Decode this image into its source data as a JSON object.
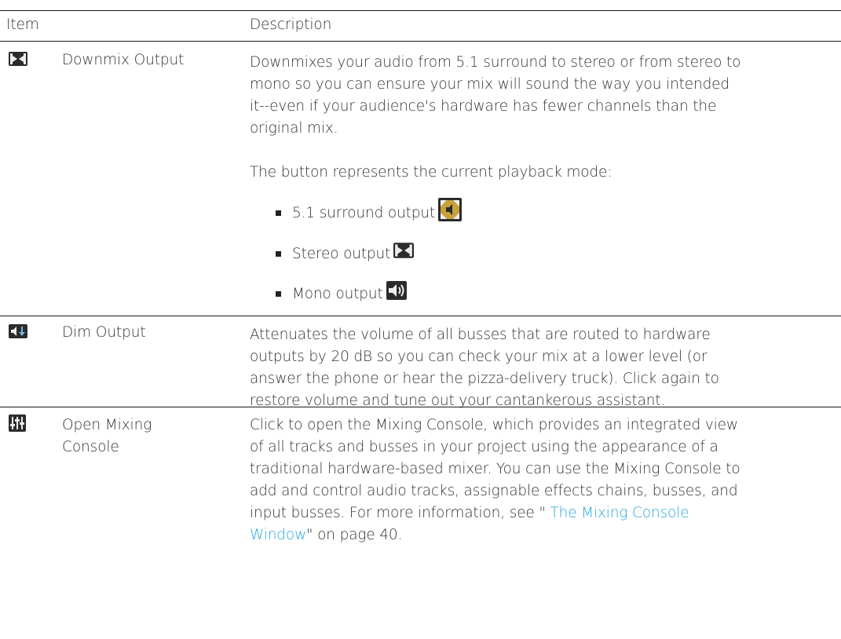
{
  "headers": {
    "item": "Item",
    "description": "Description"
  },
  "rows": [
    {
      "icon": "downmix-stereo-icon",
      "item": "Downmix Output",
      "desc_lines": [
        "Downmixes your audio from 5.1 surround to stereo or from stereo to",
        "mono so you can ensure your mix will sound the way you intended",
        "it--even if your audience's hardware has fewer channels than the",
        "original mix."
      ],
      "note": "The button represents the current playback mode:",
      "bullets": [
        {
          "text": "5.1 surround output",
          "icon": "surround-output-icon"
        },
        {
          "text": "Stereo output",
          "icon": "stereo-output-icon"
        },
        {
          "text": "Mono output",
          "icon": "mono-output-icon"
        }
      ]
    },
    {
      "icon": "dim-output-icon",
      "item": "Dim Output",
      "desc_lines": [
        "Attenuates the volume of all busses that are routed to hardware",
        "outputs by 20 dB so you can check your mix at a lower level (or",
        "answer the phone or hear the pizza-delivery truck). Click again to",
        "restore volume and tune out your cantankerous assistant."
      ]
    },
    {
      "icon": "mixing-console-icon",
      "item_lines": [
        "Open Mixing",
        "Console"
      ],
      "desc_lines": [
        "Click to open the Mixing Console, which provides an integrated view",
        "of all tracks and busses in your project using the appearance of a",
        "traditional hardware-based mixer. You can use the Mixing Console to",
        "add and control audio tracks, assignable effects chains, busses, and",
        "input busses. For more information, see \""
      ],
      "link_part1": " The Mixing Console",
      "link_part2": "Window",
      "after_link": "\" on page 40."
    }
  ],
  "colors": {
    "link": "#2aa6dc",
    "rule": "#1a1a1a",
    "icon_dark": "#2b2b2b",
    "icon_gold": "#c9a13a"
  }
}
